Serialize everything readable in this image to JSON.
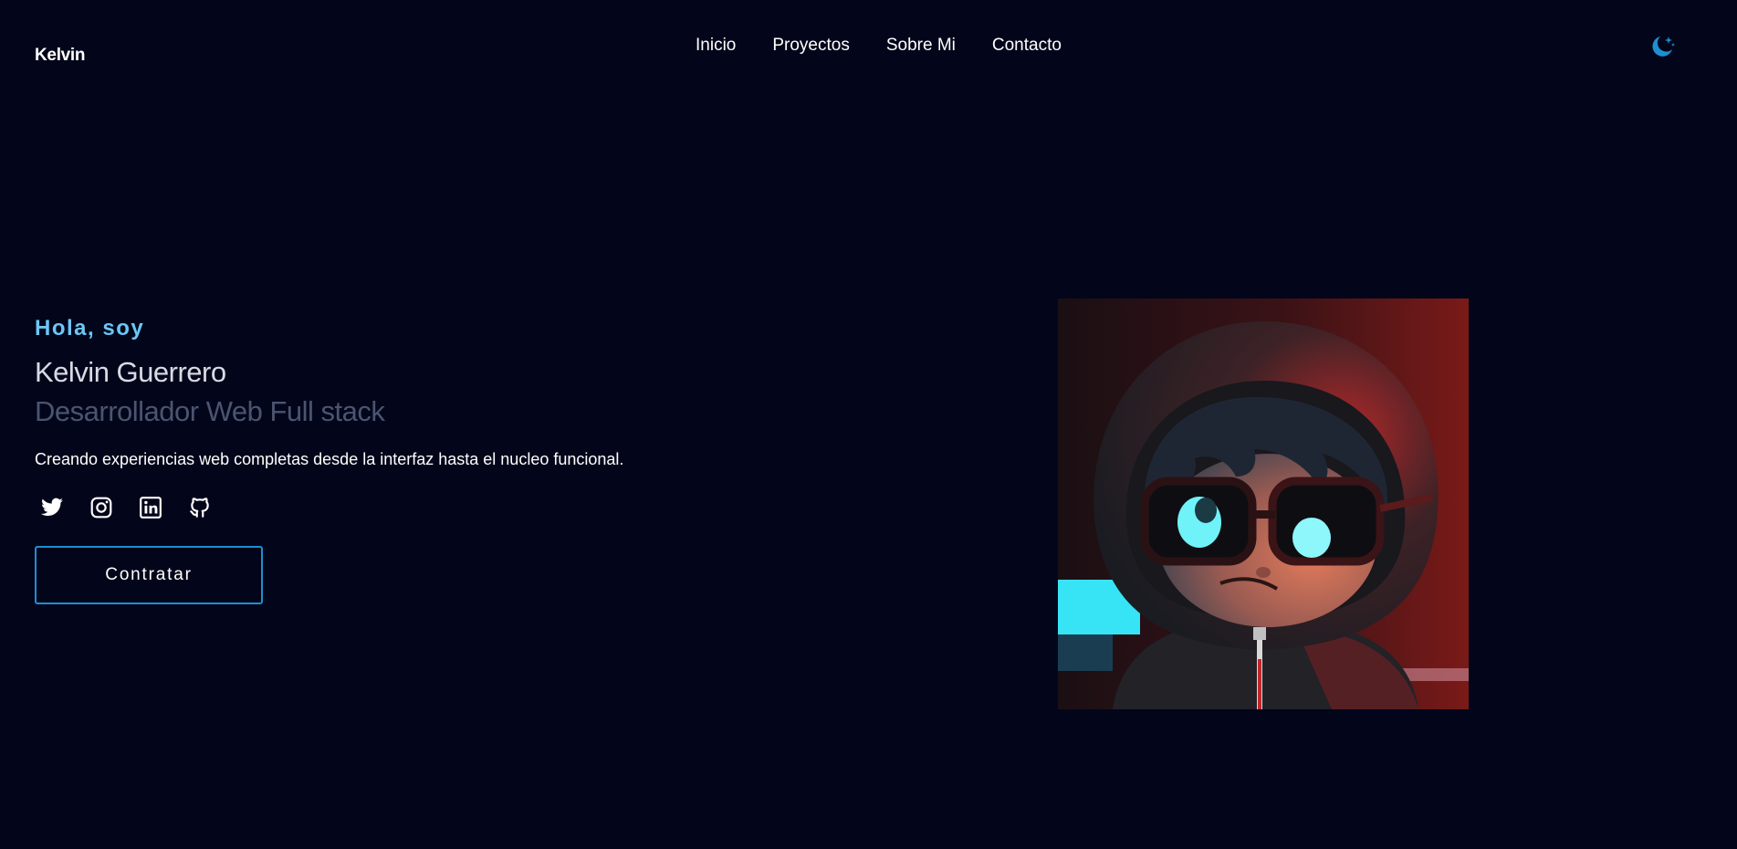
{
  "header": {
    "brand": "Kelvin",
    "nav": [
      "Inicio",
      "Proyectos",
      "Sobre Mi",
      "Contacto"
    ],
    "theme_icon": "moon-stars-icon",
    "accent_color": "#1d8fd3"
  },
  "hero": {
    "greeting": "Hola, soy",
    "name": "Kelvin Guerrero",
    "role": "Desarrollador Web Full stack",
    "tagline": "Creando experiencias web completas desde la interfaz hasta el nucleo funcional.",
    "socials": [
      "twitter-icon",
      "instagram-icon",
      "linkedin-icon",
      "github-icon"
    ],
    "cta_label": "Contratar",
    "avatar": "avatar-image"
  },
  "colors": {
    "background": "#03061a",
    "greeting": "#6cc6f6",
    "name": "#d8dbe6",
    "role": "#4b5470"
  }
}
